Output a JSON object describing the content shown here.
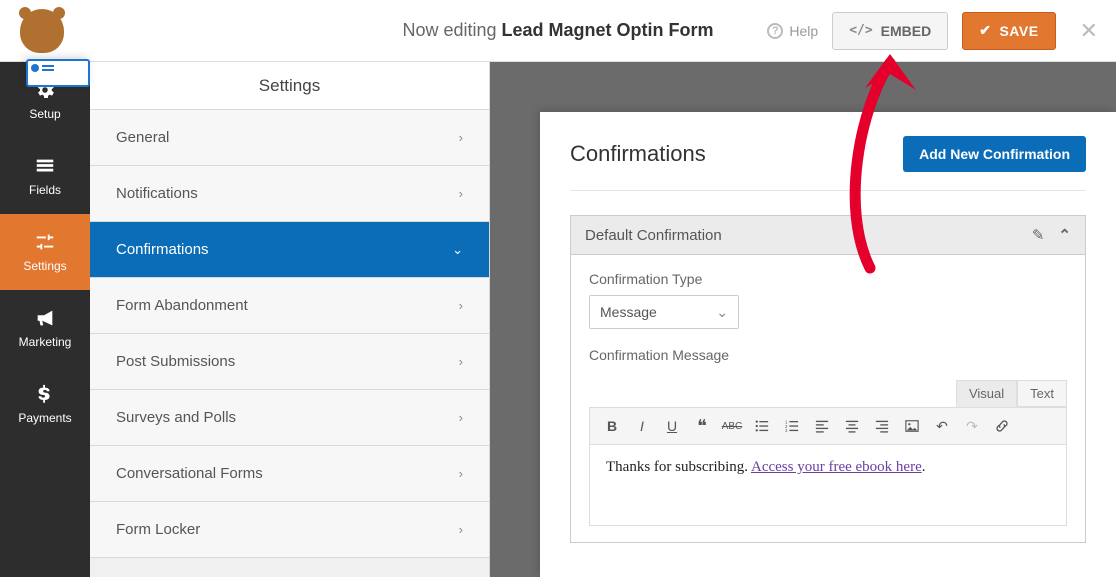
{
  "header": {
    "editing_prefix": "Now editing",
    "form_name": "Lead Magnet Optin Form",
    "help_label": "Help",
    "embed_label": "EMBED",
    "save_label": "SAVE"
  },
  "rail": {
    "items": [
      {
        "label": "Setup"
      },
      {
        "label": "Fields"
      },
      {
        "label": "Settings"
      },
      {
        "label": "Marketing"
      },
      {
        "label": "Payments"
      }
    ]
  },
  "subpanel": {
    "title": "Settings",
    "items": [
      {
        "label": "General"
      },
      {
        "label": "Notifications"
      },
      {
        "label": "Confirmations"
      },
      {
        "label": "Form Abandonment"
      },
      {
        "label": "Post Submissions"
      },
      {
        "label": "Surveys and Polls"
      },
      {
        "label": "Conversational Forms"
      },
      {
        "label": "Form Locker"
      }
    ],
    "active_index": 2
  },
  "main": {
    "title": "Confirmations",
    "add_button": "Add New Confirmation",
    "block_title": "Default Confirmation",
    "type_label": "Confirmation Type",
    "type_value": "Message",
    "message_label": "Confirmation Message",
    "editor_tabs": {
      "visual": "Visual",
      "text": "Text"
    },
    "content_plain": "Thanks for subscribing. ",
    "content_link": "Access your free ebook here",
    "content_tail": "."
  }
}
